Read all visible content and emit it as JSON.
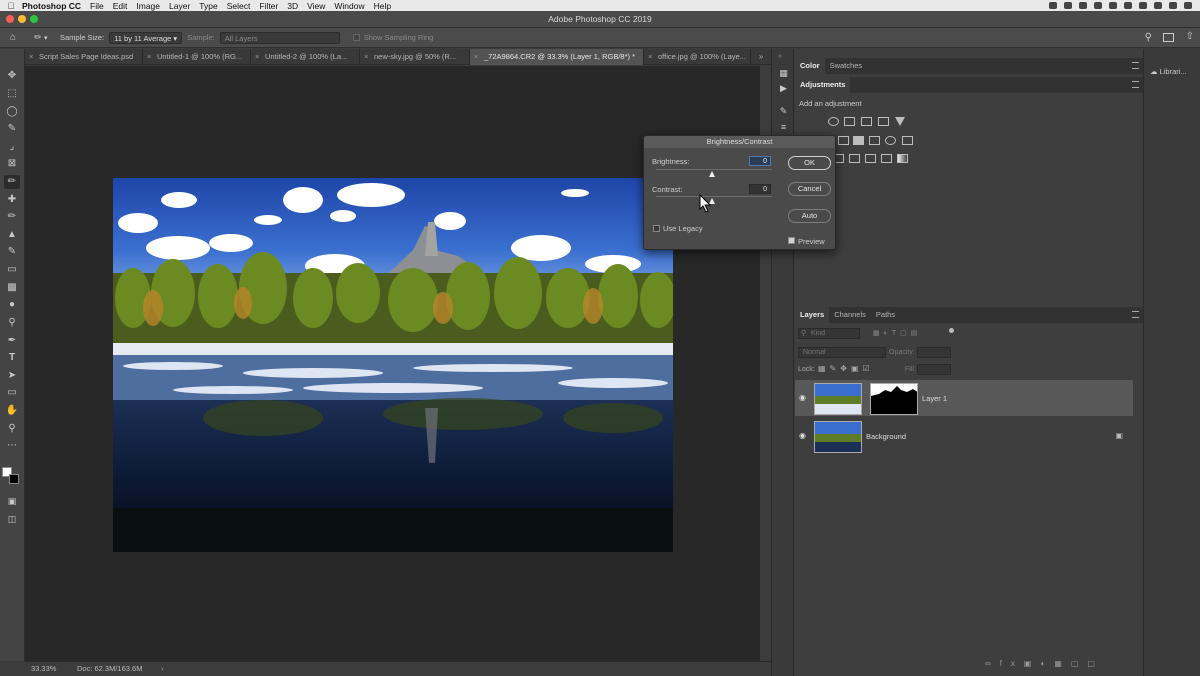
{
  "menubar": {
    "app": "Photoshop CC",
    "items": [
      "File",
      "Edit",
      "Image",
      "Layer",
      "Type",
      "Select",
      "Filter",
      "3D",
      "View",
      "Window",
      "Help"
    ]
  },
  "window": {
    "title": "Adobe Photoshop CC 2019"
  },
  "options": {
    "sample_size_label": "Sample Size:",
    "sample_size_value": "11 by 11 Average",
    "sample_label": "Sample:",
    "sample_value": "All Layers",
    "show_ring_label": "Show Sampling Ring"
  },
  "tabs": [
    "Script Sales Page Ideas.psd",
    "Untitled-1 @ 100% (RG...",
    "Untitled-2 @ 100% (La...",
    "new-sky.jpg @ 50% (R...",
    "_72A9864.CR2 @ 33.3% (Layer 1, RGB/8*) *",
    "office.jpg @ 100% (Laye..."
  ],
  "status": {
    "zoom": "33.33%",
    "doc": "Doc: 62.3M/163.6M"
  },
  "color_panel": {
    "tabs": [
      "Color",
      "Swatches"
    ]
  },
  "adjustments": {
    "tab": "Adjustments",
    "add_label": "Add an adjustment"
  },
  "dialog": {
    "title": "Brightness/Contrast",
    "brightness_label": "Brightness:",
    "brightness_value": "0",
    "contrast_label": "Contrast:",
    "contrast_value": "0",
    "use_legacy": "Use Legacy",
    "ok": "OK",
    "cancel": "Cancel",
    "auto": "Auto",
    "preview": "Preview"
  },
  "layers_panel": {
    "tabs": [
      "Layers",
      "Channels",
      "Paths"
    ],
    "kind_placeholder": "Kind",
    "blend_mode": "Normal",
    "opacity_label": "Opacity:",
    "lock_label": "Lock:",
    "fill_label": "Fill:",
    "layers": [
      {
        "name": "Layer 1"
      },
      {
        "name": "Background"
      }
    ]
  },
  "libraries": {
    "label": "Librari..."
  }
}
